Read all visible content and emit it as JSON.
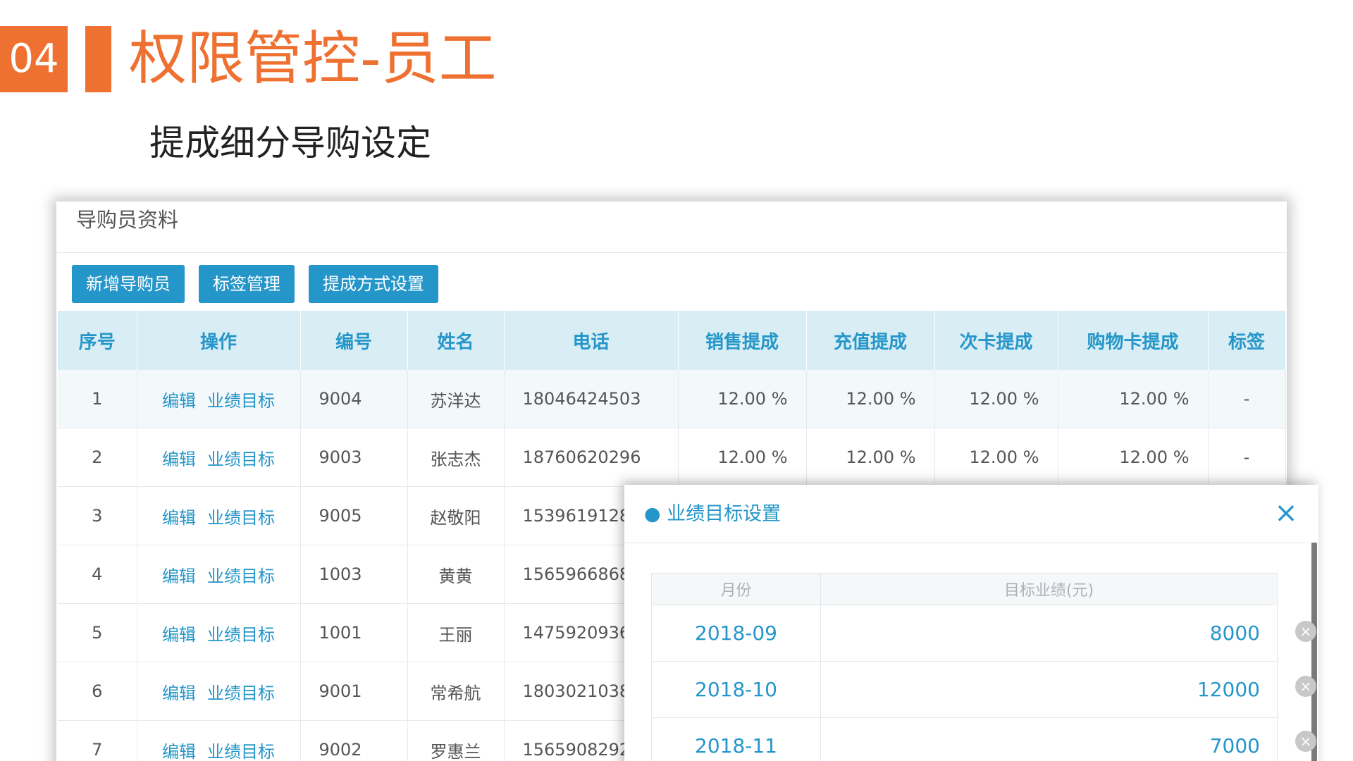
{
  "slide": {
    "number": "04",
    "title": "权限管控-员工",
    "subtitle": "提成细分导购设定"
  },
  "panel": {
    "title": "导购员资料",
    "buttons": [
      "新增导购员",
      "标签管理",
      "提成方式设置"
    ],
    "columns": [
      "序号",
      "操作",
      "编号",
      "姓名",
      "电话",
      "销售提成",
      "充值提成",
      "次卡提成",
      "购物卡提成",
      "标签"
    ],
    "action_labels": {
      "edit": "编辑",
      "target": "业绩目标"
    },
    "rows": [
      {
        "index": "1",
        "code": "9004",
        "name": "苏洋达",
        "phone": "18046424503",
        "sales": "12.00 %",
        "recharge": "12.00 %",
        "card": "12.00 %",
        "shopping": "12.00 %",
        "tag": "-"
      },
      {
        "index": "2",
        "code": "9003",
        "name": "张志杰",
        "phone": "18760620296",
        "sales": "12.00 %",
        "recharge": "12.00 %",
        "card": "12.00 %",
        "shopping": "12.00 %",
        "tag": "-"
      },
      {
        "index": "3",
        "code": "9005",
        "name": "赵敬阳",
        "phone": "1539619128",
        "sales": "",
        "recharge": "",
        "card": "",
        "shopping": "",
        "tag": ""
      },
      {
        "index": "4",
        "code": "1003",
        "name": "黄黄",
        "phone": "1565966868",
        "sales": "",
        "recharge": "",
        "card": "",
        "shopping": "",
        "tag": ""
      },
      {
        "index": "5",
        "code": "1001",
        "name": "王丽",
        "phone": "1475920936",
        "sales": "",
        "recharge": "",
        "card": "",
        "shopping": "",
        "tag": ""
      },
      {
        "index": "6",
        "code": "9001",
        "name": "常希航",
        "phone": "1803021038",
        "sales": "",
        "recharge": "",
        "card": "",
        "shopping": "",
        "tag": ""
      },
      {
        "index": "7",
        "code": "9002",
        "name": "罗惠兰",
        "phone": "1565908292",
        "sales": "",
        "recharge": "",
        "card": "",
        "shopping": "",
        "tag": ""
      }
    ]
  },
  "modal": {
    "title": "● 业绩目标设置",
    "close_icon": "×",
    "columns": [
      "月份",
      "目标业绩(元)"
    ],
    "delete_icon": "×",
    "rows": [
      {
        "month": "2018-09",
        "amount": "8000"
      },
      {
        "month": "2018-10",
        "amount": "12000"
      },
      {
        "month": "2018-11",
        "amount": "7000"
      }
    ]
  },
  "colors": {
    "accent": "#ee7132",
    "primary": "#2596c9",
    "header_bg": "#d9edf5"
  }
}
